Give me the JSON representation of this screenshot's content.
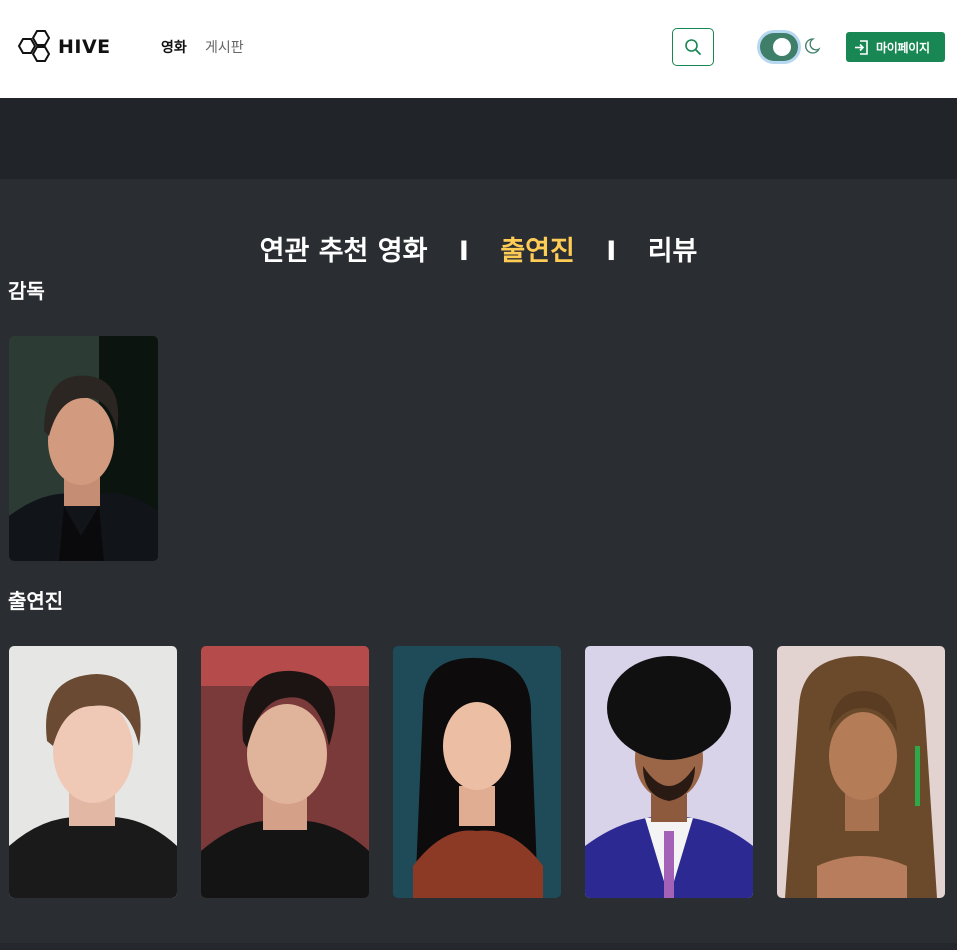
{
  "header": {
    "logo_text": "HIVE",
    "nav": [
      {
        "label": "영화"
      },
      {
        "label": "게시판"
      }
    ],
    "mypage_label": "마이페이지"
  },
  "tabs": [
    {
      "label": "연관 추천 영화",
      "active": false
    },
    {
      "label": "출연진",
      "active": true
    },
    {
      "label": "리뷰",
      "active": false
    }
  ],
  "tab_separator": "I",
  "sections": {
    "director_title": "감독",
    "cast_title": "출연진"
  },
  "colors": {
    "accent_green": "#198754",
    "active_tab": "#ffcc55",
    "page_bg": "#2a2d32"
  }
}
